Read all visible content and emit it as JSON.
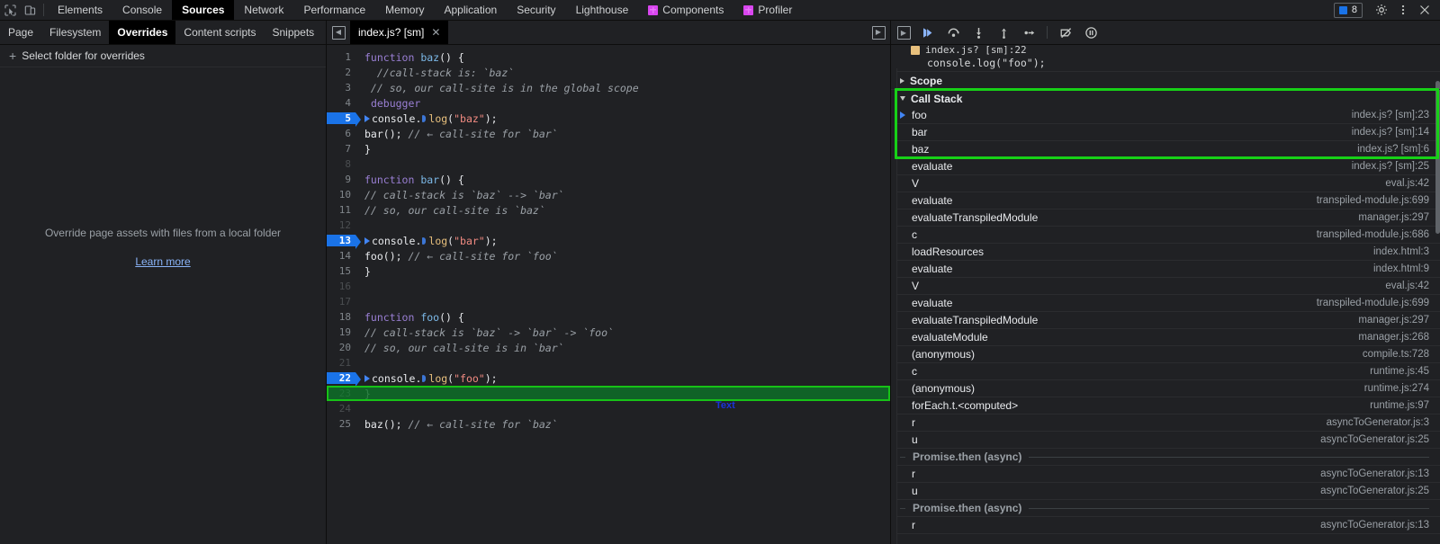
{
  "window": {
    "main_tabs": [
      {
        "label": "Elements",
        "active": false,
        "icon": null
      },
      {
        "label": "Console",
        "active": false,
        "icon": null
      },
      {
        "label": "Sources",
        "active": true,
        "icon": null
      },
      {
        "label": "Network",
        "active": false,
        "icon": null
      },
      {
        "label": "Performance",
        "active": false,
        "icon": null
      },
      {
        "label": "Memory",
        "active": false,
        "icon": null
      },
      {
        "label": "Application",
        "active": false,
        "icon": null
      },
      {
        "label": "Security",
        "active": false,
        "icon": null
      },
      {
        "label": "Lighthouse",
        "active": false,
        "icon": null
      },
      {
        "label": "Components",
        "active": false,
        "icon": "react-logo-icon"
      },
      {
        "label": "Profiler",
        "active": false,
        "icon": "react-logo-icon"
      }
    ],
    "left_icons": [
      "inspect-element-icon",
      "device-toolbar-icon"
    ],
    "issues_count": "8",
    "right_icons": [
      "settings-gear-icon",
      "more-options-icon",
      "close-icon"
    ],
    "accent_blue": "#1a73e8",
    "annotation_green": "#17d017",
    "annotation_label_blue": "#1a35d8"
  },
  "navigator": {
    "tabs": [
      {
        "label": "Page",
        "active": false
      },
      {
        "label": "Filesystem",
        "active": false
      },
      {
        "label": "Overrides",
        "active": true
      },
      {
        "label": "Content scripts",
        "active": false
      },
      {
        "label": "Snippets",
        "active": false
      }
    ],
    "more_icon": "more-options-icon",
    "select_folder_label": "Select folder for overrides",
    "empty_text": "Override page assets with files from a local folder",
    "learn_more_label": "Learn more"
  },
  "editor": {
    "tab_label": "index.js? [sm]",
    "close_icon": "close-icon",
    "panel_toggle_icon": "show-navigator-icon",
    "annotation": {
      "label": "Text",
      "target_line": 23
    },
    "lines": [
      {
        "n": 1,
        "state": "normal",
        "tokens": [
          {
            "t": "kw",
            "v": "function "
          },
          {
            "t": "fn",
            "v": "baz"
          },
          {
            "t": "plain",
            "v": "() {"
          }
        ]
      },
      {
        "n": 2,
        "state": "normal",
        "tokens": [
          {
            "t": "cmt",
            "v": "  //call-stack is: `baz`"
          }
        ]
      },
      {
        "n": 3,
        "state": "normal",
        "tokens": [
          {
            "t": "cmt",
            "v": " // so, our call-site is in the global scope"
          }
        ]
      },
      {
        "n": 4,
        "state": "normal",
        "tokens": [
          {
            "t": "plain",
            "v": " "
          },
          {
            "t": "dbg",
            "v": "debugger"
          }
        ]
      },
      {
        "n": 5,
        "state": "bp",
        "tokens": [
          {
            "t": "obj",
            "v": "console."
          },
          {
            "t": "inlinebp",
            "v": ""
          },
          {
            "t": "prop",
            "v": "log"
          },
          {
            "t": "plain",
            "v": "("
          },
          {
            "t": "str",
            "v": "\"baz\""
          },
          {
            "t": "plain",
            "v": ");"
          }
        ]
      },
      {
        "n": 6,
        "state": "normal",
        "tokens": [
          {
            "t": "obj",
            "v": "bar"
          },
          {
            "t": "plain",
            "v": "(); "
          },
          {
            "t": "cmt",
            "v": "// ← call-site for `bar`"
          }
        ]
      },
      {
        "n": 7,
        "state": "normal",
        "tokens": [
          {
            "t": "plain",
            "v": "}"
          }
        ]
      },
      {
        "n": 8,
        "state": "dim",
        "tokens": []
      },
      {
        "n": 9,
        "state": "normal",
        "tokens": [
          {
            "t": "kw",
            "v": "function "
          },
          {
            "t": "fn",
            "v": "bar"
          },
          {
            "t": "plain",
            "v": "() {"
          }
        ]
      },
      {
        "n": 10,
        "state": "normal",
        "tokens": [
          {
            "t": "cmt",
            "v": "// call-stack is `baz` --> `bar`"
          }
        ]
      },
      {
        "n": 11,
        "state": "normal",
        "tokens": [
          {
            "t": "cmt",
            "v": "// so, our call-site is `baz`"
          }
        ]
      },
      {
        "n": 12,
        "state": "dim",
        "tokens": []
      },
      {
        "n": 13,
        "state": "bp",
        "tokens": [
          {
            "t": "obj",
            "v": "console."
          },
          {
            "t": "inlinebp",
            "v": ""
          },
          {
            "t": "prop",
            "v": "log"
          },
          {
            "t": "plain",
            "v": "("
          },
          {
            "t": "str",
            "v": "\"bar\""
          },
          {
            "t": "plain",
            "v": ");"
          }
        ]
      },
      {
        "n": 14,
        "state": "normal",
        "tokens": [
          {
            "t": "obj",
            "v": "foo"
          },
          {
            "t": "plain",
            "v": "(); "
          },
          {
            "t": "cmt",
            "v": "// ← call-site for `foo`"
          }
        ]
      },
      {
        "n": 15,
        "state": "normal",
        "tokens": [
          {
            "t": "plain",
            "v": "}"
          }
        ]
      },
      {
        "n": 16,
        "state": "dim",
        "tokens": []
      },
      {
        "n": 17,
        "state": "dim",
        "tokens": []
      },
      {
        "n": 18,
        "state": "normal",
        "tokens": [
          {
            "t": "kw",
            "v": "function "
          },
          {
            "t": "fn",
            "v": "foo"
          },
          {
            "t": "plain",
            "v": "() {"
          }
        ]
      },
      {
        "n": 19,
        "state": "normal",
        "tokens": [
          {
            "t": "cmt",
            "v": "// call-stack is `baz` -> `bar` -> `foo`"
          }
        ]
      },
      {
        "n": 20,
        "state": "normal",
        "tokens": [
          {
            "t": "cmt",
            "v": "// so, our call-site is in `bar`"
          }
        ]
      },
      {
        "n": 21,
        "state": "dim",
        "tokens": []
      },
      {
        "n": 22,
        "state": "exec",
        "tokens": [
          {
            "t": "obj",
            "v": "console."
          },
          {
            "t": "inlinebp",
            "v": ""
          },
          {
            "t": "prop",
            "v": "log"
          },
          {
            "t": "plain",
            "v": "("
          },
          {
            "t": "str",
            "v": "\"foo\""
          },
          {
            "t": "plain",
            "v": ");"
          }
        ]
      },
      {
        "n": 23,
        "state": "normal",
        "tokens": [
          {
            "t": "plain",
            "v": "}"
          }
        ]
      },
      {
        "n": 24,
        "state": "dim",
        "tokens": []
      },
      {
        "n": 25,
        "state": "normal",
        "tokens": [
          {
            "t": "obj",
            "v": "baz"
          },
          {
            "t": "plain",
            "v": "(); "
          },
          {
            "t": "cmt",
            "v": "// ← call-site for `baz`"
          }
        ]
      }
    ]
  },
  "debugger": {
    "toolbar_buttons": [
      {
        "name": "resume-script-execution-button",
        "icon": "resume-icon",
        "primary": true
      },
      {
        "name": "step-over-button",
        "icon": "step-over-icon",
        "primary": false
      },
      {
        "name": "step-into-button",
        "icon": "step-into-icon",
        "primary": false
      },
      {
        "name": "step-out-button",
        "icon": "step-out-icon",
        "primary": false
      },
      {
        "name": "step-button",
        "icon": "step-icon",
        "primary": false
      },
      {
        "name": "deactivate-breakpoints-button",
        "icon": "deactivate-breakpoints-icon",
        "primary": false
      },
      {
        "name": "pause-on-exceptions-button",
        "icon": "pause-icon",
        "primary": false
      }
    ],
    "panel_toggle_icon": "show-debugger-sidebar-icon",
    "breakpoint_preview": {
      "file": "index.js? [sm]:22",
      "code": "console.log(\"foo\");"
    },
    "scope_section": {
      "label": "Scope",
      "expanded": false
    },
    "call_stack_section": {
      "label": "Call Stack",
      "expanded": true
    },
    "call_stack": [
      {
        "name": "foo",
        "location": "index.js? [sm]:23",
        "selected": true,
        "async": false,
        "highlighted": true
      },
      {
        "name": "bar",
        "location": "index.js? [sm]:14",
        "selected": false,
        "async": false,
        "highlighted": true
      },
      {
        "name": "baz",
        "location": "index.js? [sm]:6",
        "selected": false,
        "async": false,
        "highlighted": true
      },
      {
        "name": "evaluate",
        "location": "index.js? [sm]:25",
        "selected": false,
        "async": false,
        "highlighted": false
      },
      {
        "name": "V",
        "location": "eval.js:42",
        "selected": false,
        "async": false,
        "highlighted": false
      },
      {
        "name": "evaluate",
        "location": "transpiled-module.js:699",
        "selected": false,
        "async": false,
        "highlighted": false
      },
      {
        "name": "evaluateTranspiledModule",
        "location": "manager.js:297",
        "selected": false,
        "async": false,
        "highlighted": false
      },
      {
        "name": "c",
        "location": "transpiled-module.js:686",
        "selected": false,
        "async": false,
        "highlighted": false
      },
      {
        "name": "loadResources",
        "location": "index.html:3",
        "selected": false,
        "async": false,
        "highlighted": false
      },
      {
        "name": "evaluate",
        "location": "index.html:9",
        "selected": false,
        "async": false,
        "highlighted": false
      },
      {
        "name": "V",
        "location": "eval.js:42",
        "selected": false,
        "async": false,
        "highlighted": false
      },
      {
        "name": "evaluate",
        "location": "transpiled-module.js:699",
        "selected": false,
        "async": false,
        "highlighted": false
      },
      {
        "name": "evaluateTranspiledModule",
        "location": "manager.js:297",
        "selected": false,
        "async": false,
        "highlighted": false
      },
      {
        "name": "evaluateModule",
        "location": "manager.js:268",
        "selected": false,
        "async": false,
        "highlighted": false
      },
      {
        "name": "(anonymous)",
        "location": "compile.ts:728",
        "selected": false,
        "async": false,
        "highlighted": false
      },
      {
        "name": "c",
        "location": "runtime.js:45",
        "selected": false,
        "async": false,
        "highlighted": false
      },
      {
        "name": "(anonymous)",
        "location": "runtime.js:274",
        "selected": false,
        "async": false,
        "highlighted": false
      },
      {
        "name": "forEach.t.<computed>",
        "location": "runtime.js:97",
        "selected": false,
        "async": false,
        "highlighted": false
      },
      {
        "name": "r",
        "location": "asyncToGenerator.js:3",
        "selected": false,
        "async": false,
        "highlighted": false
      },
      {
        "name": "u",
        "location": "asyncToGenerator.js:25",
        "selected": false,
        "async": false,
        "highlighted": false
      },
      {
        "name": "Promise.then (async)",
        "location": "",
        "selected": false,
        "async": true,
        "highlighted": false
      },
      {
        "name": "r",
        "location": "asyncToGenerator.js:13",
        "selected": false,
        "async": false,
        "highlighted": false
      },
      {
        "name": "u",
        "location": "asyncToGenerator.js:25",
        "selected": false,
        "async": false,
        "highlighted": false
      },
      {
        "name": "Promise.then (async)",
        "location": "",
        "selected": false,
        "async": true,
        "highlighted": false
      },
      {
        "name": "r",
        "location": "asyncToGenerator.js:13",
        "selected": false,
        "async": false,
        "highlighted": false
      }
    ]
  }
}
